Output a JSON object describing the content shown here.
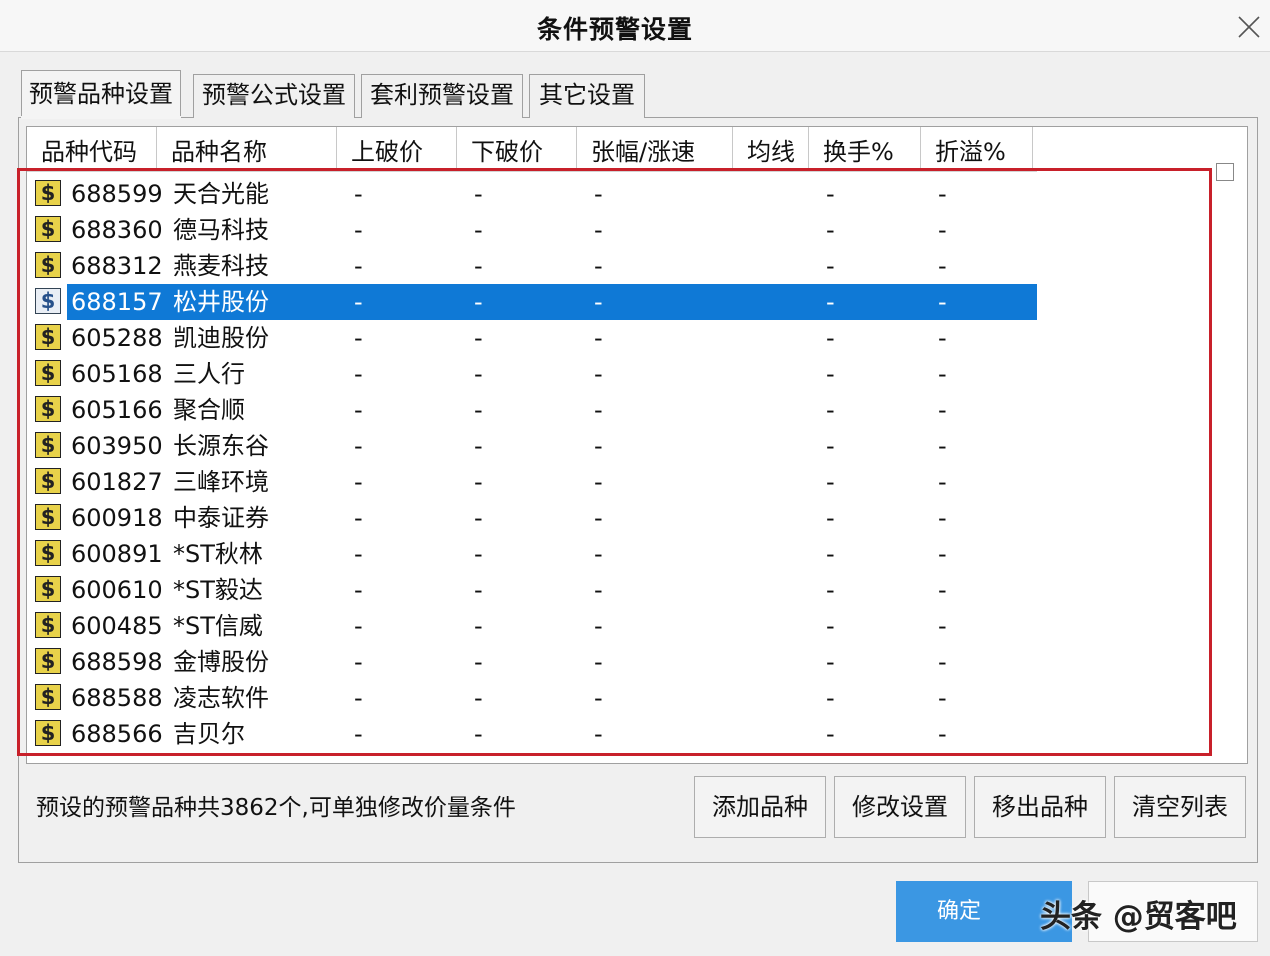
{
  "window": {
    "title": "条件预警设置",
    "close_icon": "close-icon"
  },
  "tabs": [
    {
      "label": "预警品种设置",
      "active": true
    },
    {
      "label": "预警公式设置",
      "active": false
    },
    {
      "label": "套利预警设置",
      "active": false
    },
    {
      "label": "其它设置",
      "active": false
    }
  ],
  "columns": [
    "品种代码",
    "品种名称",
    "上破价",
    "下破价",
    "张幅/涨速",
    "均线",
    "换手%",
    "折溢%"
  ],
  "row_icon": "dollar-sign-icon",
  "rows": [
    {
      "code": "688599",
      "name": "天合光能",
      "up": "-",
      "down": "-",
      "range": "-",
      "ma": "",
      "turnover": "-",
      "premium": "-"
    },
    {
      "code": "688360",
      "name": "德马科技",
      "up": "-",
      "down": "-",
      "range": "-",
      "ma": "",
      "turnover": "-",
      "premium": "-"
    },
    {
      "code": "688312",
      "name": "燕麦科技",
      "up": "-",
      "down": "-",
      "range": "-",
      "ma": "",
      "turnover": "-",
      "premium": "-"
    },
    {
      "code": "688157",
      "name": "松井股份",
      "up": "-",
      "down": "-",
      "range": "-",
      "ma": "",
      "turnover": "-",
      "premium": "-",
      "selected": true
    },
    {
      "code": "605288",
      "name": "凯迪股份",
      "up": "-",
      "down": "-",
      "range": "-",
      "ma": "",
      "turnover": "-",
      "premium": "-"
    },
    {
      "code": "605168",
      "name": "三人行",
      "up": "-",
      "down": "-",
      "range": "-",
      "ma": "",
      "turnover": "-",
      "premium": "-"
    },
    {
      "code": "605166",
      "name": "聚合顺",
      "up": "-",
      "down": "-",
      "range": "-",
      "ma": "",
      "turnover": "-",
      "premium": "-"
    },
    {
      "code": "603950",
      "name": "长源东谷",
      "up": "-",
      "down": "-",
      "range": "-",
      "ma": "",
      "turnover": "-",
      "premium": "-"
    },
    {
      "code": "601827",
      "name": "三峰环境",
      "up": "-",
      "down": "-",
      "range": "-",
      "ma": "",
      "turnover": "-",
      "premium": "-"
    },
    {
      "code": "600918",
      "name": "中泰证券",
      "up": "-",
      "down": "-",
      "range": "-",
      "ma": "",
      "turnover": "-",
      "premium": "-"
    },
    {
      "code": "600891",
      "name": "*ST秋林",
      "up": "-",
      "down": "-",
      "range": "-",
      "ma": "",
      "turnover": "-",
      "premium": "-"
    },
    {
      "code": "600610",
      "name": "*ST毅达",
      "up": "-",
      "down": "-",
      "range": "-",
      "ma": "",
      "turnover": "-",
      "premium": "-"
    },
    {
      "code": "600485",
      "name": "*ST信威",
      "up": "-",
      "down": "-",
      "range": "-",
      "ma": "",
      "turnover": "-",
      "premium": "-"
    },
    {
      "code": "688598",
      "name": "金博股份",
      "up": "-",
      "down": "-",
      "range": "-",
      "ma": "",
      "turnover": "-",
      "premium": "-"
    },
    {
      "code": "688588",
      "name": "凌志软件",
      "up": "-",
      "down": "-",
      "range": "-",
      "ma": "",
      "turnover": "-",
      "premium": "-"
    },
    {
      "code": "688566",
      "name": "吉贝尔",
      "up": "-",
      "down": "-",
      "range": "-",
      "ma": "",
      "turnover": "-",
      "premium": "-"
    }
  ],
  "status_text": "预设的预警品种共3862个,可单独修改价量条件",
  "buttons": {
    "add": "添加品种",
    "modify": "修改设置",
    "remove": "移出品种",
    "clear": "清空列表"
  },
  "footer": {
    "ok": "确定",
    "watermark": "头条 @贸客吧"
  },
  "colors": {
    "selection": "#0f79d6",
    "highlight_frame": "#c8202a",
    "ok_button": "#3b97e3"
  }
}
